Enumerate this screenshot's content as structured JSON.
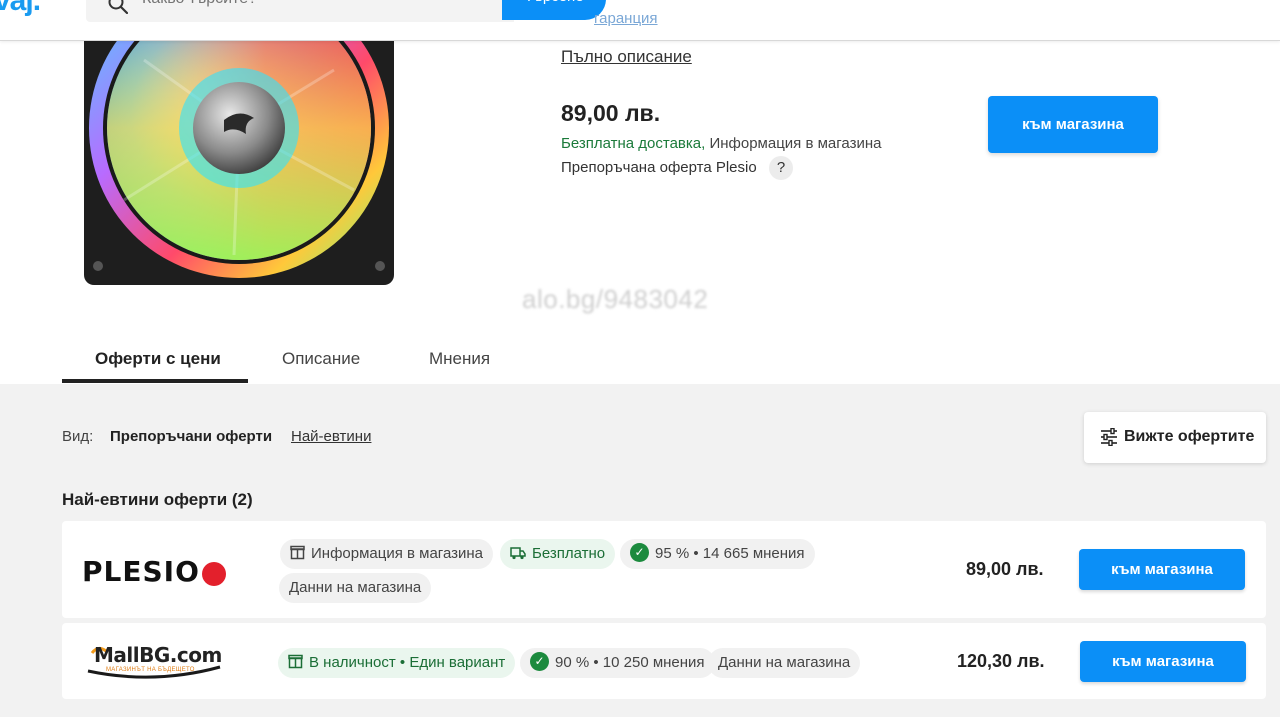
{
  "header": {
    "logo_fragment": "vaj.",
    "search_placeholder": "Какво търсите?",
    "search_button": "Търсене",
    "link_fragment": "гаранция"
  },
  "product": {
    "full_description_link": "Пълно описание",
    "price": "89,00 лв.",
    "delivery_free": "Безплатна доставка,",
    "delivery_info": "Информация в магазина",
    "recommended_offer": "Препоръчана оферта Plesio",
    "help": "?",
    "store_button": "към магазина",
    "watermark": "alo.bg/9483042",
    "image_icon": "rgb-fan-image"
  },
  "tabs": [
    {
      "label": "Оферти с цени",
      "active": true
    },
    {
      "label": "Описание",
      "active": false
    },
    {
      "label": "Мнения",
      "active": false
    }
  ],
  "view": {
    "label": "Вид:",
    "recommended": "Препоръчани оферти",
    "cheapest": "Най-евтини"
  },
  "filter_button": "Вижте офертите",
  "offers_title": "Най-евтини оферти (2)",
  "offers": [
    {
      "store": "PLESIO",
      "chips": [
        {
          "icon": "box-icon",
          "text": "Информация в магазина",
          "style": "grey"
        },
        {
          "icon": "truck-icon",
          "text": "Безплатно",
          "style": "green"
        },
        {
          "icon": "check-icon",
          "text": "95 % • 14 665 мнения",
          "style": "grey"
        },
        {
          "icon": "",
          "text": "Данни на магазина",
          "style": "grey"
        }
      ],
      "price": "89,00 лв.",
      "button": "към магазина"
    },
    {
      "store": "MallBG.com",
      "store_tagline": "МАГАЗИНЪТ НА БЪДЕЩЕТО",
      "chips": [
        {
          "icon": "box-icon",
          "text": "В наличност • Един вариант",
          "style": "green"
        },
        {
          "icon": "check-icon",
          "text": "90 % • 10 250 мнения",
          "style": "grey"
        },
        {
          "icon": "",
          "text": "Данни на магазина",
          "style": "grey"
        }
      ],
      "price": "120,30 лв.",
      "button": "към магазина"
    }
  ],
  "colors": {
    "accent": "#0b8ff7",
    "green": "#1b6e36",
    "plesio_red": "#e3202c"
  }
}
